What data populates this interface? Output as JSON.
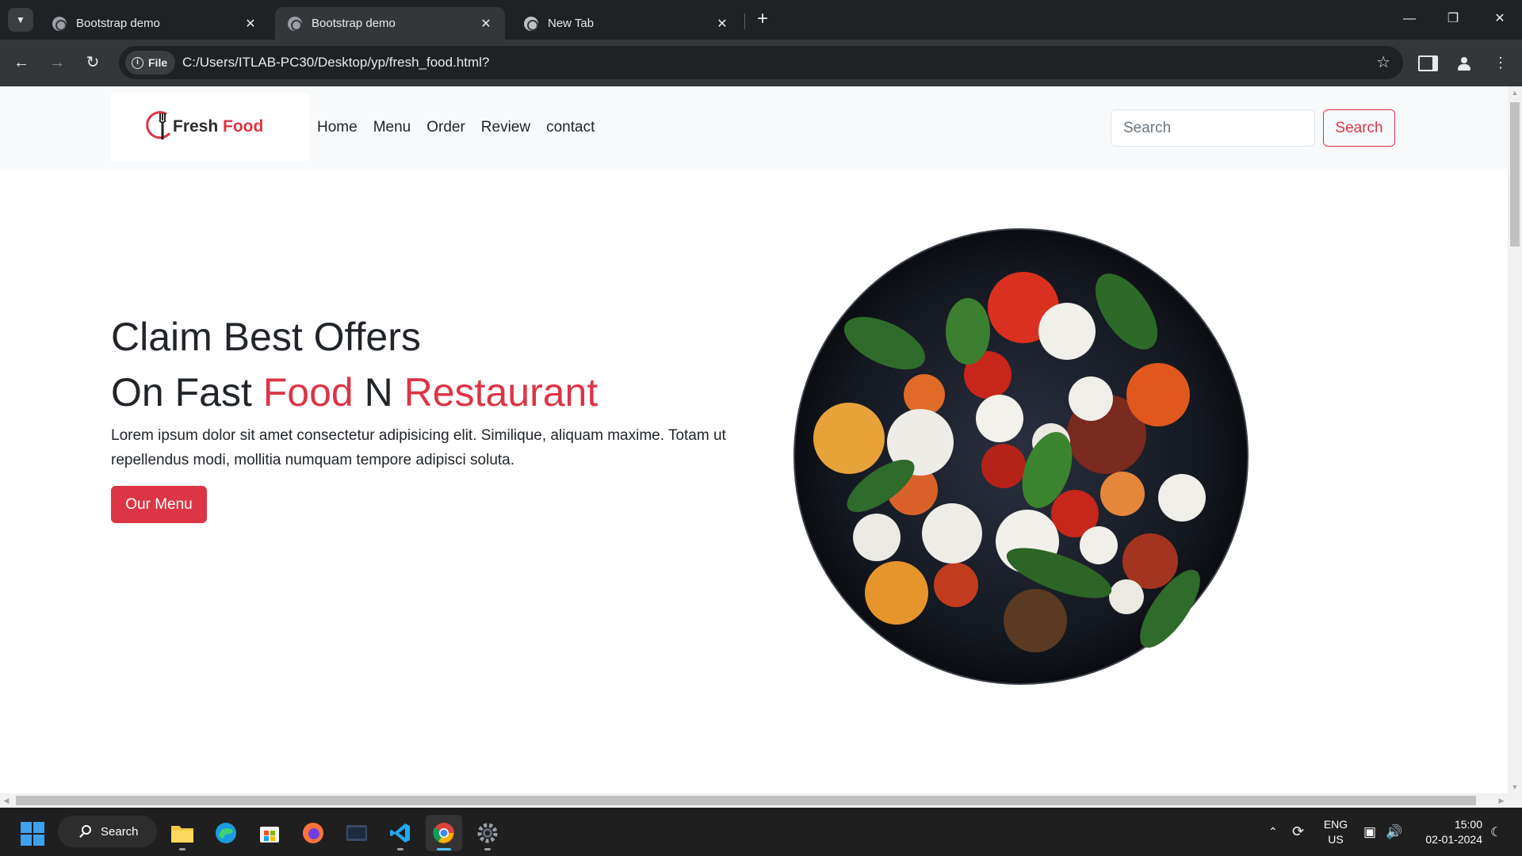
{
  "browser": {
    "tabs": [
      {
        "title": "Bootstrap demo",
        "active": false
      },
      {
        "title": "Bootstrap demo",
        "active": true
      },
      {
        "title": "New Tab",
        "active": false
      }
    ],
    "address_chip": "File",
    "url": "C:/Users/ITLAB-PC30/Desktop/yp/fresh_food.html?"
  },
  "site": {
    "brand": {
      "part1": "Fresh",
      "part2": "Food"
    },
    "nav": [
      "Home",
      "Menu",
      "Order",
      "Review",
      "contact"
    ],
    "search": {
      "placeholder": "Search",
      "button": "Search"
    },
    "hero": {
      "line1": "Claim Best Offers",
      "line2_a": "On Fast",
      "line2_b": "Food",
      "line2_c": "N",
      "line2_d": "Restaurant",
      "text": "Lorem ipsum dolor sit amet consectetur adipisicing elit. Similique, aliquam maxime. Totam ut repellendus modi, mollitia numquam tempore adipisci soluta.",
      "button": "Our Menu"
    },
    "accent_color": "#dc3545"
  },
  "taskbar": {
    "search_label": "Search",
    "lang_line1": "ENG",
    "lang_line2": "US",
    "time": "15:00",
    "date": "02-01-2024"
  }
}
